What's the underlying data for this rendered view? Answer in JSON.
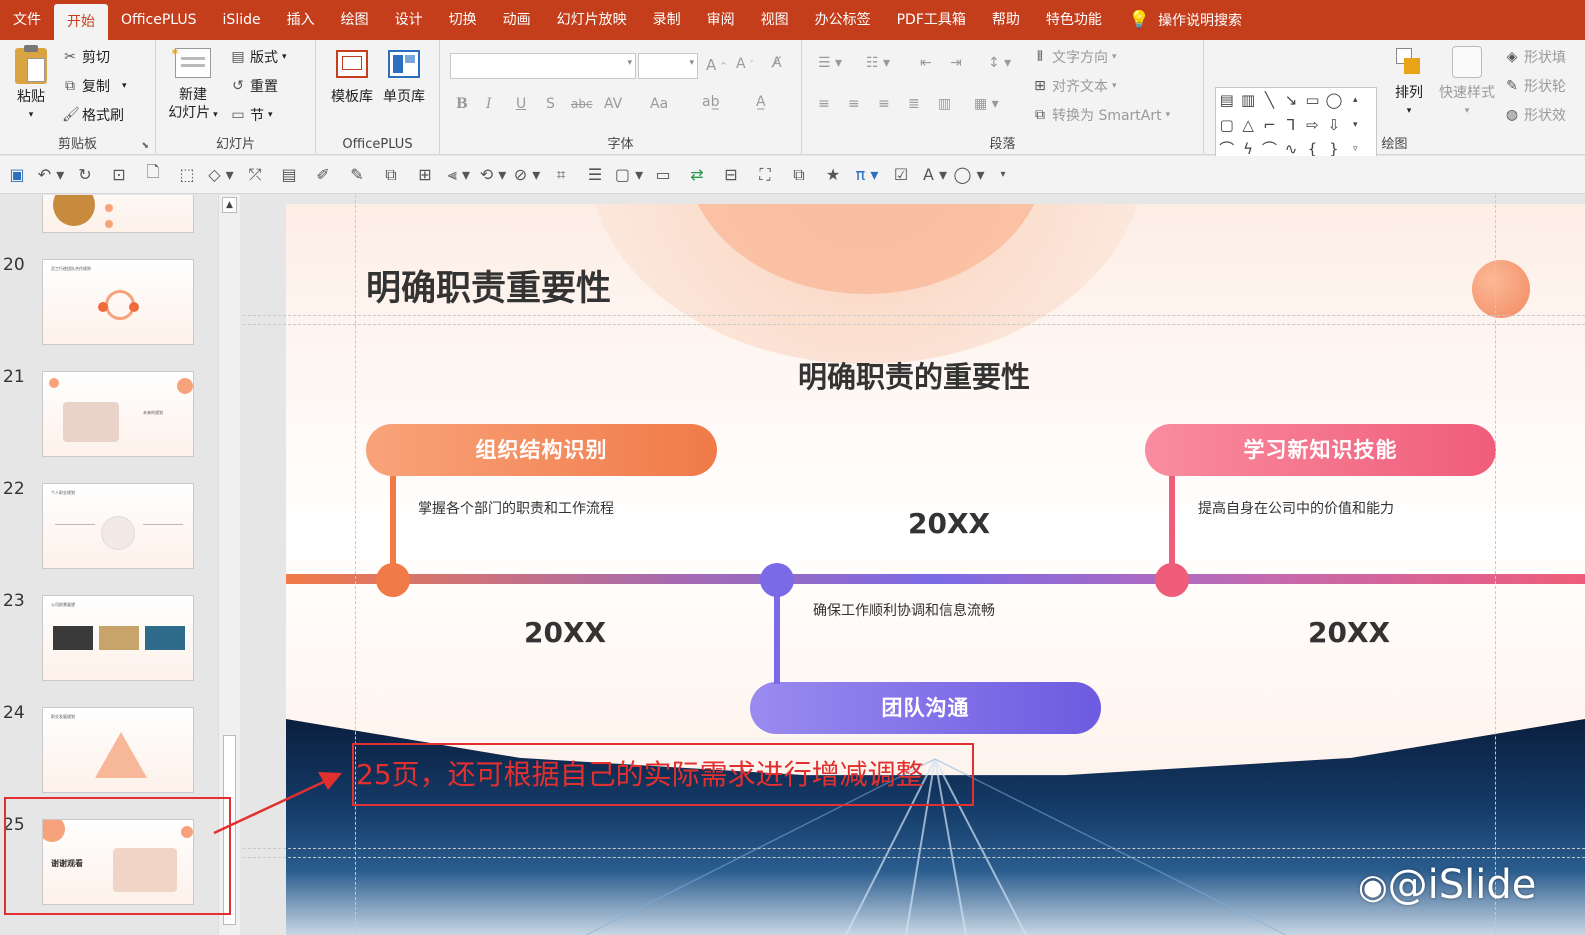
{
  "menu": {
    "tabs": [
      "文件",
      "开始",
      "OfficePLUS",
      "iSlide",
      "插入",
      "绘图",
      "设计",
      "切换",
      "动画",
      "幻灯片放映",
      "录制",
      "审阅",
      "视图",
      "办公标签",
      "PDF工具箱",
      "帮助",
      "特色功能"
    ],
    "active": "开始",
    "search_label": "操作说明搜索"
  },
  "ribbon": {
    "clipboard": {
      "paste": "粘贴",
      "cut": "剪切",
      "copy": "复制",
      "format_painter": "格式刷",
      "label": "剪贴板"
    },
    "slides": {
      "new_line1": "新建",
      "new_line2": "幻灯片",
      "layout": "版式",
      "reset": "重置",
      "section": "节",
      "label": "幻灯片"
    },
    "officeplus": {
      "template": "模板库",
      "single": "单页库",
      "label": "OfficePLUS"
    },
    "font": {
      "label": "字体",
      "bold": "B",
      "italic": "I",
      "underline": "U",
      "shadow": "S",
      "strike": "abc",
      "spacing": "AV",
      "case": "Aa"
    },
    "paragraph": {
      "label": "段落",
      "text_direction": "文字方向",
      "align_text": "对齐文本",
      "smartart": "转换为 SmartArt"
    },
    "drawing": {
      "label": "绘图",
      "arrange": "排列",
      "quick_styles": "快速样式",
      "fill": "形状填",
      "outline": "形状轮",
      "effects": "形状效"
    }
  },
  "thumbnails": [
    {
      "num": "20",
      "title": "员工行使团队合作规则"
    },
    {
      "num": "21",
      "title": "未来的规划"
    },
    {
      "num": "22",
      "title": "个人职业规划"
    },
    {
      "num": "23",
      "title": "公司前景展望"
    },
    {
      "num": "24",
      "title": "职业发展规划"
    },
    {
      "num": "25",
      "title": "谢谢观看"
    }
  ],
  "slide": {
    "title": "明确职责重要性",
    "subtitle": "明确职责的重要性",
    "items": [
      {
        "label": "组织结构识别",
        "desc": "掌握各个部门的职责和工作流程",
        "year": "20XX",
        "color": "#f07a48"
      },
      {
        "label": "团队沟通",
        "desc": "确保工作顺利协调和信息流畅",
        "year": "20XX",
        "color": "#7b6ae6"
      },
      {
        "label": "学习新知识技能",
        "desc": "提高自身在公司中的价值和能力",
        "year": "20XX",
        "color": "#f05d7a"
      }
    ]
  },
  "callout": {
    "text": "25页，还可根据自己的实际需求进行增减调整",
    "color": "#e23030"
  },
  "watermark": "@iSlide"
}
